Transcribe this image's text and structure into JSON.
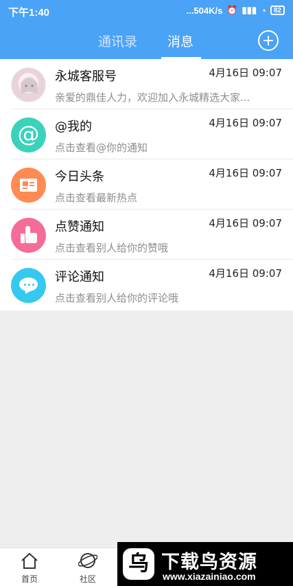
{
  "status_bar": {
    "time": "下午1:40",
    "network": "...504K/s",
    "battery": "82"
  },
  "header": {
    "tabs": [
      {
        "label": "通讯录",
        "active": false
      },
      {
        "label": "消息",
        "active": true
      }
    ],
    "accent_color": "#4aa3f6"
  },
  "messages": [
    {
      "title": "永城客服号",
      "time": "4月16日 09:07",
      "preview": "亲爱的鼎佳人力，欢迎加入永城精选大家...",
      "icon": "customer-service-avatar"
    },
    {
      "title": "@我的",
      "time": "4月16日 09:07",
      "preview": "点击查看@你的通知",
      "icon": "at-icon"
    },
    {
      "title": "今日头条",
      "time": "4月16日 09:07",
      "preview": "点击查看最新热点",
      "icon": "newspaper-icon"
    },
    {
      "title": "点赞通知",
      "time": "4月16日 09:07",
      "preview": "点击查看别人给你的赞哦",
      "icon": "thumbs-up-icon"
    },
    {
      "title": "评论通知",
      "time": "4月16日 09:07",
      "preview": "点击查看别人给你的评论哦",
      "icon": "comment-icon"
    }
  ],
  "bottom_nav": [
    {
      "label": "首页",
      "icon": "home-icon"
    },
    {
      "label": "社区",
      "icon": "planet-icon"
    }
  ],
  "watermark": {
    "logo": "乌",
    "title": "下载鸟资源",
    "url": "www.xiazainiao.com"
  }
}
